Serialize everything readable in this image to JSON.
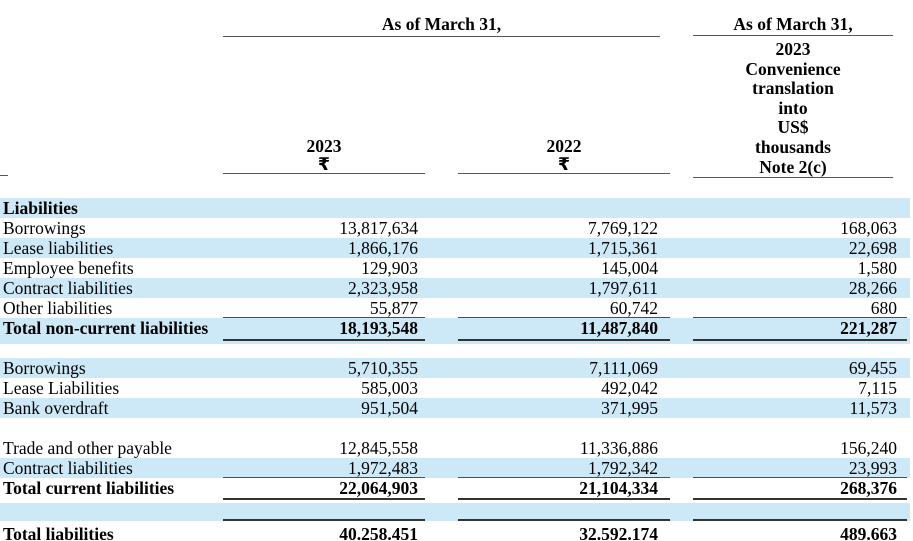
{
  "header": {
    "group1_title": "As of March 31,",
    "col1": {
      "year": "2023",
      "currency": "₹"
    },
    "col2": {
      "year": "2022",
      "currency": "₹"
    },
    "group2": {
      "title": "As of March 31,",
      "lines": [
        "2023",
        "Convenience",
        "translation",
        "into",
        "US$",
        "thousands",
        "Note 2(c)"
      ]
    }
  },
  "rows": [
    {
      "label": "Liabilities",
      "v1": "",
      "v2": "",
      "v3": ""
    },
    {
      "label": "Borrowings",
      "v1": "13,817,634",
      "v2": "7,769,122",
      "v3": "168,063"
    },
    {
      "label": "Lease liabilities",
      "v1": "1,866,176",
      "v2": "1,715,361",
      "v3": "22,698"
    },
    {
      "label": "Employee benefits",
      "v1": "129,903",
      "v2": "145,004",
      "v3": "1,580"
    },
    {
      "label": "Contract liabilities",
      "v1": "2,323,958",
      "v2": "1,797,611",
      "v3": "28,266"
    },
    {
      "label": "Other liabilities",
      "v1": "55,877",
      "v2": "60,742",
      "v3": "680"
    },
    {
      "label": "Total non-current liabilities",
      "v1": "18,193,548",
      "v2": "11,487,840",
      "v3": "221,287"
    },
    {
      "label": "Borrowings",
      "v1": "5,710,355",
      "v2": "7,111,069",
      "v3": "69,455"
    },
    {
      "label": "Lease Liabilities",
      "v1": "585,003",
      "v2": "492,042",
      "v3": "7,115"
    },
    {
      "label": "Bank overdraft",
      "v1": "951,504",
      "v2": "371,995",
      "v3": "11,573"
    },
    {
      "label": "Trade and other payable",
      "v1": "12,845,558",
      "v2": "11,336,886",
      "v3": "156,240"
    },
    {
      "label": "Contract liabilities",
      "v1": "1,972,483",
      "v2": "1,792,342",
      "v3": "23,993"
    },
    {
      "label": "Total current liabilities",
      "v1": "22,064,903",
      "v2": "21,104,334",
      "v3": "268,376"
    },
    {
      "label": "",
      "v1": "",
      "v2": "",
      "v3": ""
    },
    {
      "label": "Total liabilities",
      "v1": "40.258.451",
      "v2": "32.592.174",
      "v3": "489.663"
    }
  ],
  "colors": {
    "stripe_blue": "#cde9f8",
    "rule_gray": "#4d4d4d",
    "rule_heavy": "#333333",
    "text": "#000000"
  }
}
